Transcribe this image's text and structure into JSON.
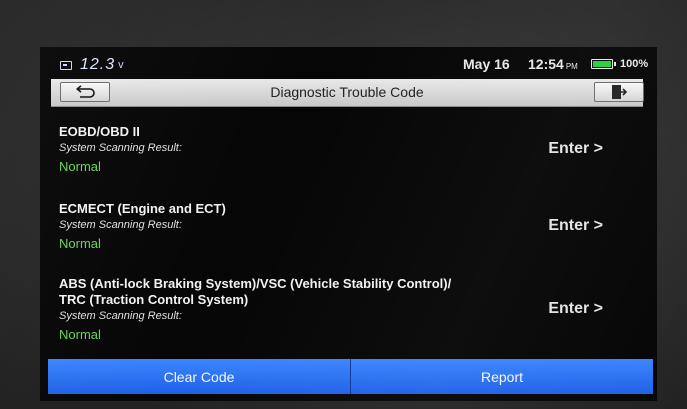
{
  "status": {
    "voltage": "12.3",
    "voltage_unit": "v",
    "date": "May 16",
    "time": "12:54",
    "ampm": "PM",
    "battery_percent": "100%",
    "battery_level": 1.0,
    "battery_color": "#22d33a"
  },
  "titlebar": {
    "title": "Diagnostic Trouble Code",
    "back_icon": "back-arrow-icon",
    "exit_icon": "exit-icon"
  },
  "entries": [
    {
      "name": "EOBD/OBD II",
      "subtitle": "System Scanning Result:",
      "result": "Normal",
      "action": "Enter >"
    },
    {
      "name": "ECMECT (Engine and ECT)",
      "subtitle": "System Scanning Result:",
      "result": "Normal",
      "action": "Enter >"
    },
    {
      "name_line1": "ABS (Anti-lock Braking System)/VSC (Vehicle Stability Control)/",
      "name_line2": "TRC (Traction Control System)",
      "subtitle": "System Scanning Result:",
      "result": "Normal",
      "action": "Enter >"
    }
  ],
  "colors": {
    "result_normal": "#6bd35a",
    "button_blue": "#2a72f5"
  },
  "bottom": {
    "clear_label": "Clear Code",
    "report_label": "Report"
  }
}
